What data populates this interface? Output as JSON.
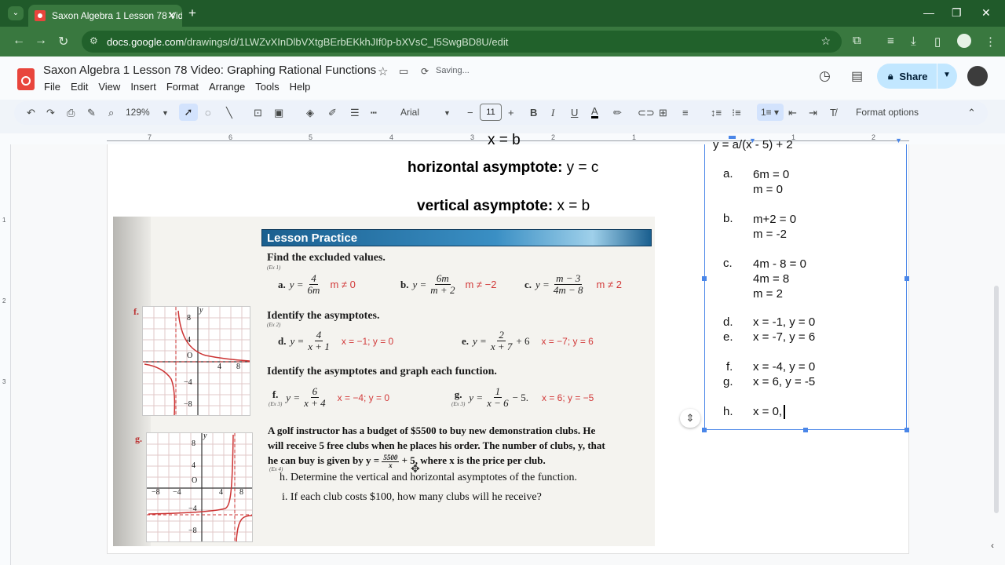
{
  "browser": {
    "tab_title": "Saxon Algebra 1 Lesson 78 Vide",
    "url_host": "docs.google.com",
    "url_path": "/drawings/d/1LWZvXInDlbVXtgBErbEKkhJIf0p-bXVsC_I5SwgBD8U/edit"
  },
  "docs": {
    "title": "Saxon Algebra 1 Lesson 78 Video: Graphing Rational Functions",
    "status": "Saving...",
    "share_label": "Share",
    "menus": [
      "File",
      "Edit",
      "View",
      "Insert",
      "Format",
      "Arrange",
      "Tools",
      "Help"
    ]
  },
  "toolbar": {
    "zoom": "129%",
    "font": "Arial",
    "font_size": "11",
    "format_options": "Format options"
  },
  "ruler": {
    "numbers": [
      "7",
      "6",
      "5",
      "4",
      "3",
      "2",
      "1",
      "1",
      "2"
    ]
  },
  "canvas": {
    "cut_top": "x = b",
    "h_label": "horizontal asymptote:",
    "h_value": " y = c",
    "v_label": "vertical asymptote:",
    "v_value": " x = b"
  },
  "textbook": {
    "banner": "Lesson Practice",
    "heading1": "Find the excluded values.",
    "ex1": "(Ex 1)",
    "a": {
      "label": "a.",
      "lhs": "y =",
      "num": "4",
      "den": "6m",
      "answer": "m ≠ 0"
    },
    "b": {
      "label": "b.",
      "lhs": "y =",
      "num": "6m",
      "den": "m + 2",
      "answer": "m ≠ −2"
    },
    "c": {
      "label": "c.",
      "lhs": "y =",
      "num": "m − 3",
      "den": "4m − 8",
      "answer": "m ≠ 2"
    },
    "heading2": "Identify the asymptotes.",
    "ex2": "(Ex 2)",
    "d": {
      "label": "d.",
      "lhs": "y =",
      "num": "4",
      "den": "x + 1",
      "answer": "x = −1; y = 0"
    },
    "e": {
      "label": "e.",
      "lhs": "y =",
      "num": "2",
      "den": "x + 7",
      "tail": "+ 6",
      "answer": "x = −7; y = 6"
    },
    "heading3": "Identify the asymptotes and graph each function.",
    "f": {
      "label": "f.",
      "ex": "(Ex 3)",
      "lhs": "y =",
      "num": "6",
      "den": "x + 4",
      "answer": "x = −4; y = 0"
    },
    "g": {
      "label": "g.",
      "ex": "(Ex 3)",
      "lhs": "y =",
      "num": "1",
      "den": "x − 6",
      "tail": "− 5.",
      "answer": "x = 6; y = −5"
    },
    "problem_line1": "A golf instructor has a budget of $5500 to buy new demonstration clubs. He",
    "problem_line2": "will receive 5 free clubs when he places his order. The number of clubs, y, that",
    "problem_line3a": "he can buy is given by y =",
    "problem_frac_num": "5500",
    "problem_frac_den": "x",
    "problem_line3b": "+ 5, where x is the price per club.",
    "ex4": "(Ex 4)",
    "h_q": "h. Determine the vertical and horizontal asymptotes of the function.",
    "i_q": "i. If each club costs $100, how many clubs will he receive?",
    "graph_f": {
      "label": "f.",
      "y": "y",
      "ticks_y": [
        "8",
        "4",
        "−4",
        "−8"
      ],
      "ticks_x": [
        "4",
        "8"
      ],
      "origin": "O"
    },
    "graph_g": {
      "label": "g.",
      "y": "y",
      "ticks_y": [
        "8",
        "4",
        "−4",
        "−8"
      ],
      "ticks_x": [
        "−8",
        "−4",
        "4",
        "8"
      ],
      "origin": "O"
    }
  },
  "answers": {
    "top": "y = a/(x - 5) + 2",
    "items": [
      {
        "letter": "a.",
        "lines": [
          "6m = 0",
          "m = 0"
        ]
      },
      {
        "letter": "b.",
        "lines": [
          "m+2 = 0",
          "m = -2"
        ]
      },
      {
        "letter": "c.",
        "lines": [
          "4m - 8 = 0",
          "4m = 8",
          "m = 2"
        ]
      },
      {
        "letter": "d.",
        "lines": [
          "x = -1, y = 0"
        ]
      },
      {
        "letter": "e.",
        "lines": [
          "x = -7, y = 6"
        ]
      },
      {
        "letter": "f.",
        "lines": [
          "x = -4, y = 0"
        ]
      },
      {
        "letter": "g.",
        "lines": [
          "x = 6, y = -5"
        ]
      },
      {
        "letter": "h.",
        "lines": [
          "x = 0,"
        ]
      }
    ]
  },
  "colors": {
    "accent": "#4a86e8",
    "chrome": "#205a2a",
    "answer_red": "#d23a3a"
  }
}
